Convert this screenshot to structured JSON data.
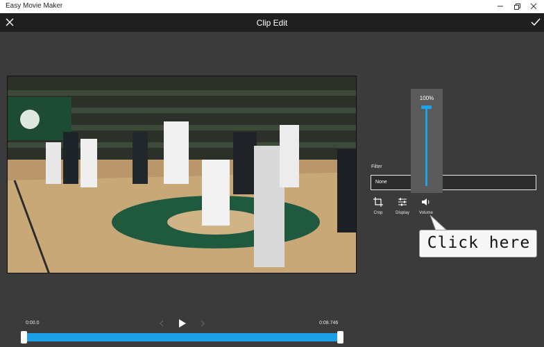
{
  "window": {
    "app_title": "Easy Movie Maker"
  },
  "header": {
    "title": "Clip Edit"
  },
  "filter": {
    "label": "Filter",
    "value": "None"
  },
  "tools": [
    {
      "label": "Crop",
      "icon": "crop-icon"
    },
    {
      "label": "Display",
      "icon": "display-sliders-icon"
    },
    {
      "label": "Volume",
      "icon": "volume-icon"
    }
  ],
  "volume": {
    "percent_label": "100%",
    "level": 1.0
  },
  "callout": {
    "text": "Click here"
  },
  "playback": {
    "start_time": "0:00.0",
    "end_time": "0:08.746",
    "trim_start": 0.0,
    "trim_end": 1.0
  },
  "colors": {
    "accent": "#1ea1e8",
    "background": "#3b3b3b",
    "header": "#1f1f1f",
    "volume_panel": "#5a5a5a"
  }
}
